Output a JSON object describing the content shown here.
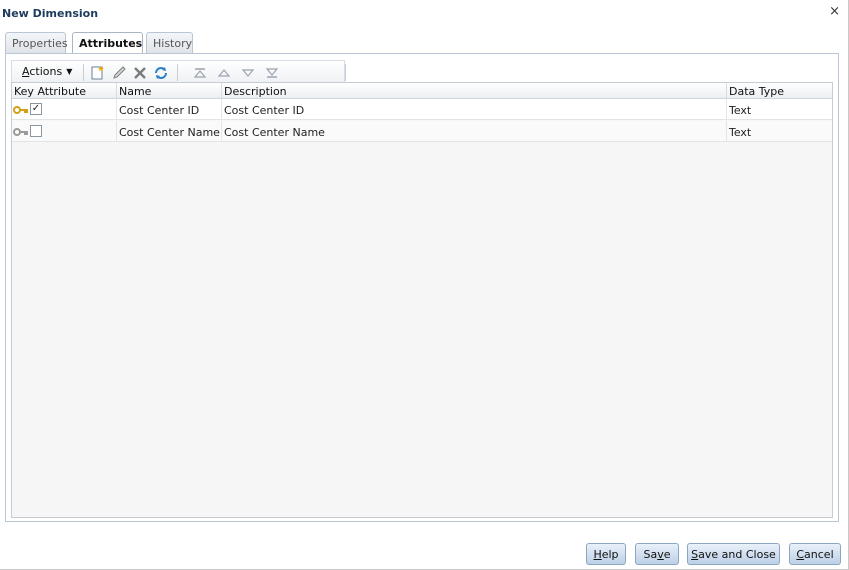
{
  "dialog": {
    "title": "New Dimension",
    "close_glyph": "×"
  },
  "tabs": [
    {
      "label": "Properties",
      "active": false
    },
    {
      "label": "Attributes",
      "active": true
    },
    {
      "label": "History",
      "active": false
    }
  ],
  "toolbar": {
    "actions_label_underlined": "A",
    "actions_label_rest": "ctions",
    "icons": [
      "new-icon",
      "edit-icon",
      "delete-icon",
      "refresh-icon",
      "move-top-icon",
      "move-up-icon",
      "move-down-icon",
      "move-bottom-icon"
    ]
  },
  "table": {
    "columns": [
      "Key Attribute",
      "Name",
      "Description",
      "Data Type"
    ],
    "rows": [
      {
        "key_checked": true,
        "name": "Cost Center ID",
        "description": "Cost Center ID",
        "data_type": "Text"
      },
      {
        "key_checked": false,
        "name": "Cost Center Name",
        "description": "Cost Center Name",
        "data_type": "Text"
      }
    ]
  },
  "buttons": {
    "help": {
      "u": "H",
      "rest": "elp"
    },
    "save": {
      "pre": "Sa",
      "u": "v",
      "rest": "e"
    },
    "save_close": {
      "u": "S",
      "rest": "ave and Close"
    },
    "cancel": {
      "u": "C",
      "rest": "ancel"
    }
  },
  "colors": {
    "title": "#1d3b5c",
    "key_active": "#d4a017",
    "key_inactive": "#9a9a9a",
    "button_accent": "#bcd0e7"
  }
}
